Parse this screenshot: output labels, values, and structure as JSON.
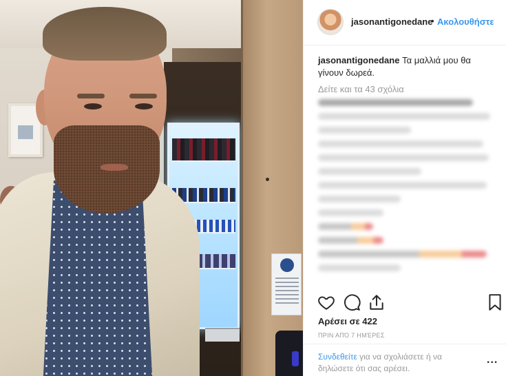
{
  "post": {
    "username": "jasonantigonedane",
    "separator": "•",
    "follow_label": "Ακολουθήστε",
    "caption_text": "Τα μαλλιά μου θα γίνουν δωρεά.",
    "view_comments_label": "Δείτε και τα 43 σχόλια",
    "likes_label": "Αρέσει σε 422",
    "timestamp": "ΠΡΙΝ ΑΠΌ 7 ΗΜΈΡΕΣ",
    "login_link": "Συνδεθείτε",
    "login_rest": "για να σχολιάσετε ή να δηλώσετε ότι σας αρέσει.",
    "more_label": "..."
  },
  "icons": {
    "like": "heart-icon",
    "comment": "comment-bubble-icon",
    "share": "share-icon",
    "save": "bookmark-icon"
  },
  "colors": {
    "link_blue": "#3897f0",
    "text": "#262626",
    "muted": "#999999"
  }
}
